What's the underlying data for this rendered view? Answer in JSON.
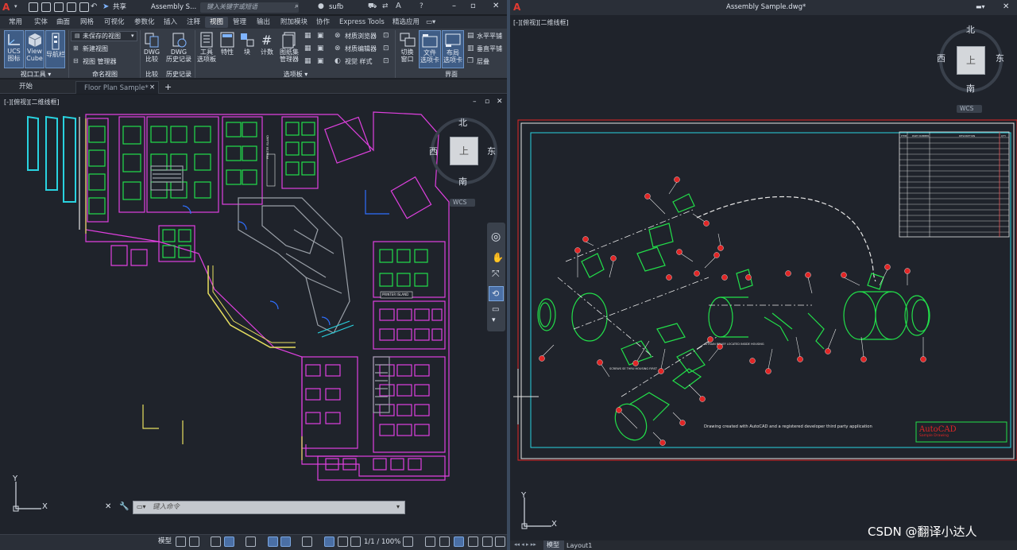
{
  "app": {
    "logo": "A",
    "title": "Assembly S...",
    "share_label": "共享",
    "search_placeholder": "键入关键字或短语",
    "user": "sufb"
  },
  "ribbon_tabs": [
    "常用",
    "实体",
    "曲面",
    "网格",
    "可视化",
    "参数化",
    "插入",
    "注释",
    "视图",
    "管理",
    "输出",
    "附加模块",
    "协作",
    "Express Tools",
    "精选应用"
  ],
  "ribbon": {
    "viewport_tools": {
      "ucs_label": "UCS\n图标",
      "viewcube_label": "View\nCube",
      "navbar_label": "导航栏",
      "panel_title": "视口工具"
    },
    "named_views": {
      "dropdown_value": "未保存的视图",
      "new_view": "新建视图",
      "view_manager": "视图 管理器",
      "panel_title": "命名视图"
    },
    "compare": {
      "dwg_compare": "DWG\n比较",
      "panel_title": "比较"
    },
    "history": {
      "dwg_history": "DWG\n历史记录",
      "panel_title": "历史记录"
    },
    "palettes": {
      "tool_palettes": "工具\n选项板",
      "properties": "特性",
      "block": "块",
      "count": "计数",
      "sheet_set": "图纸集\n管理器",
      "material_browser": "材质浏览器",
      "material_editor": "材质编辑器",
      "visual_styles": "视觉 样式",
      "panel_title": "选项板"
    },
    "interface": {
      "switch_window": "切换\n窗口",
      "file_tabs": "文件\n选项卡",
      "layout_tabs": "布局\n选项卡",
      "tile_h": "水平平铺",
      "tile_v": "垂直平铺",
      "cascade": "层叠",
      "panel_title": "界面"
    }
  },
  "doc_tabs": {
    "start": "开始",
    "active": "Floor Plan Sample*",
    "add": "+"
  },
  "left_viewport": {
    "header": "[-][俯视][二维线框]",
    "viewcube": {
      "north": "北",
      "south": "南",
      "east": "东",
      "west": "西",
      "face": "上",
      "wcs": "WCS"
    },
    "plan_labels": [
      "PRINTER ISLAND",
      "PRINTER ISLAND"
    ],
    "command_placeholder": "键入命令",
    "axis_x": "X",
    "axis_y": "Y"
  },
  "right_window": {
    "title": "Assembly Sample.dwg*",
    "header": "[-][俯视][二维线框]",
    "viewcube": {
      "north": "北",
      "south": "南",
      "east": "东",
      "west": "西",
      "face": "上",
      "wcs": "WCS"
    },
    "note": "Drawing created with AutoCAD and a registered developer third party application",
    "title_block_brand": "AutoCAD",
    "title_block_sub": "Sample Drawing",
    "bom_headers": [
      "ITEM",
      "PART NUMBER",
      "DESCRIPTION",
      "QTY"
    ],
    "callouts": [
      "SCREWS SE THRU HOUSING FIRST",
      "STRAIN RELIEF LOCATED INSIDE HOUSING"
    ],
    "axis_x": "X",
    "axis_y": "Y",
    "tabs": {
      "model": "模型",
      "layout": "Layout1"
    }
  },
  "status_bar": {
    "model": "模型",
    "scale": "1/1 / 100%"
  },
  "watermark": "CSDN @翻译小达人",
  "colors": {
    "bg": "#1f232b",
    "ribbon": "#363c46",
    "magenta": "#e040e0",
    "cyan": "#29d3e0",
    "green": "#22e04a",
    "red": "#e02626"
  }
}
